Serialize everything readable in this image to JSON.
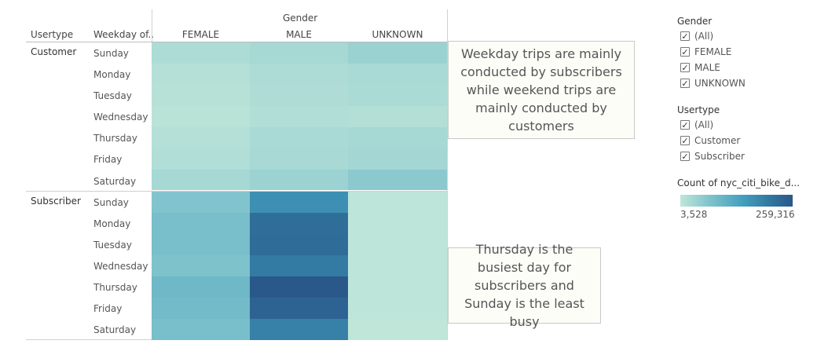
{
  "chart_data": {
    "type": "heatmap",
    "column_group_title": "Gender",
    "row_header_1": "Usertype",
    "row_header_2": "Weekday of..",
    "columns": [
      "FEMALE",
      "MALE",
      "UNKNOWN"
    ],
    "usertypes": [
      {
        "name": "Customer",
        "days": [
          "Sunday",
          "Monday",
          "Tuesday",
          "Wednesday",
          "Thursday",
          "Friday",
          "Saturday"
        ],
        "values": [
          [
            22000,
            30000,
            42000
          ],
          [
            14000,
            22000,
            26000
          ],
          [
            12000,
            20000,
            24000
          ],
          [
            9000,
            18000,
            16000
          ],
          [
            14000,
            26000,
            30000
          ],
          [
            18000,
            28000,
            32000
          ],
          [
            30000,
            40000,
            58000
          ]
        ]
      },
      {
        "name": "Subscriber",
        "days": [
          "Sunday",
          "Monday",
          "Tuesday",
          "Wednesday",
          "Thursday",
          "Friday",
          "Saturday"
        ],
        "values": [
          [
            68000,
            168000,
            6000
          ],
          [
            80000,
            222000,
            5000
          ],
          [
            80000,
            226000,
            5000
          ],
          [
            72000,
            200000,
            5000
          ],
          [
            92000,
            259316,
            5000
          ],
          [
            86000,
            240000,
            5000
          ],
          [
            78000,
            192000,
            3528
          ]
        ]
      }
    ],
    "color_scale": {
      "min": 3528,
      "max": 259316,
      "min_label": "3,528",
      "max_label": "259,316",
      "low_color": "#bfe6d9",
      "high_color": "#2a5a8a"
    },
    "annotations": [
      "Weekday trips are mainly conducted by subscribers while weekend trips are mainly conducted by customers",
      "Thursday is the busiest day for subscribers and Sunday is the least busy"
    ]
  },
  "filters": {
    "gender": {
      "title": "Gender",
      "items": [
        "(All)",
        "FEMALE",
        "MALE",
        "UNKNOWN"
      ]
    },
    "usertype": {
      "title": "Usertype",
      "items": [
        "(All)",
        "Customer",
        "Subscriber"
      ]
    },
    "check_glyph": "✓"
  },
  "legend": {
    "title": "Count of nyc_citi_bike_d..."
  }
}
